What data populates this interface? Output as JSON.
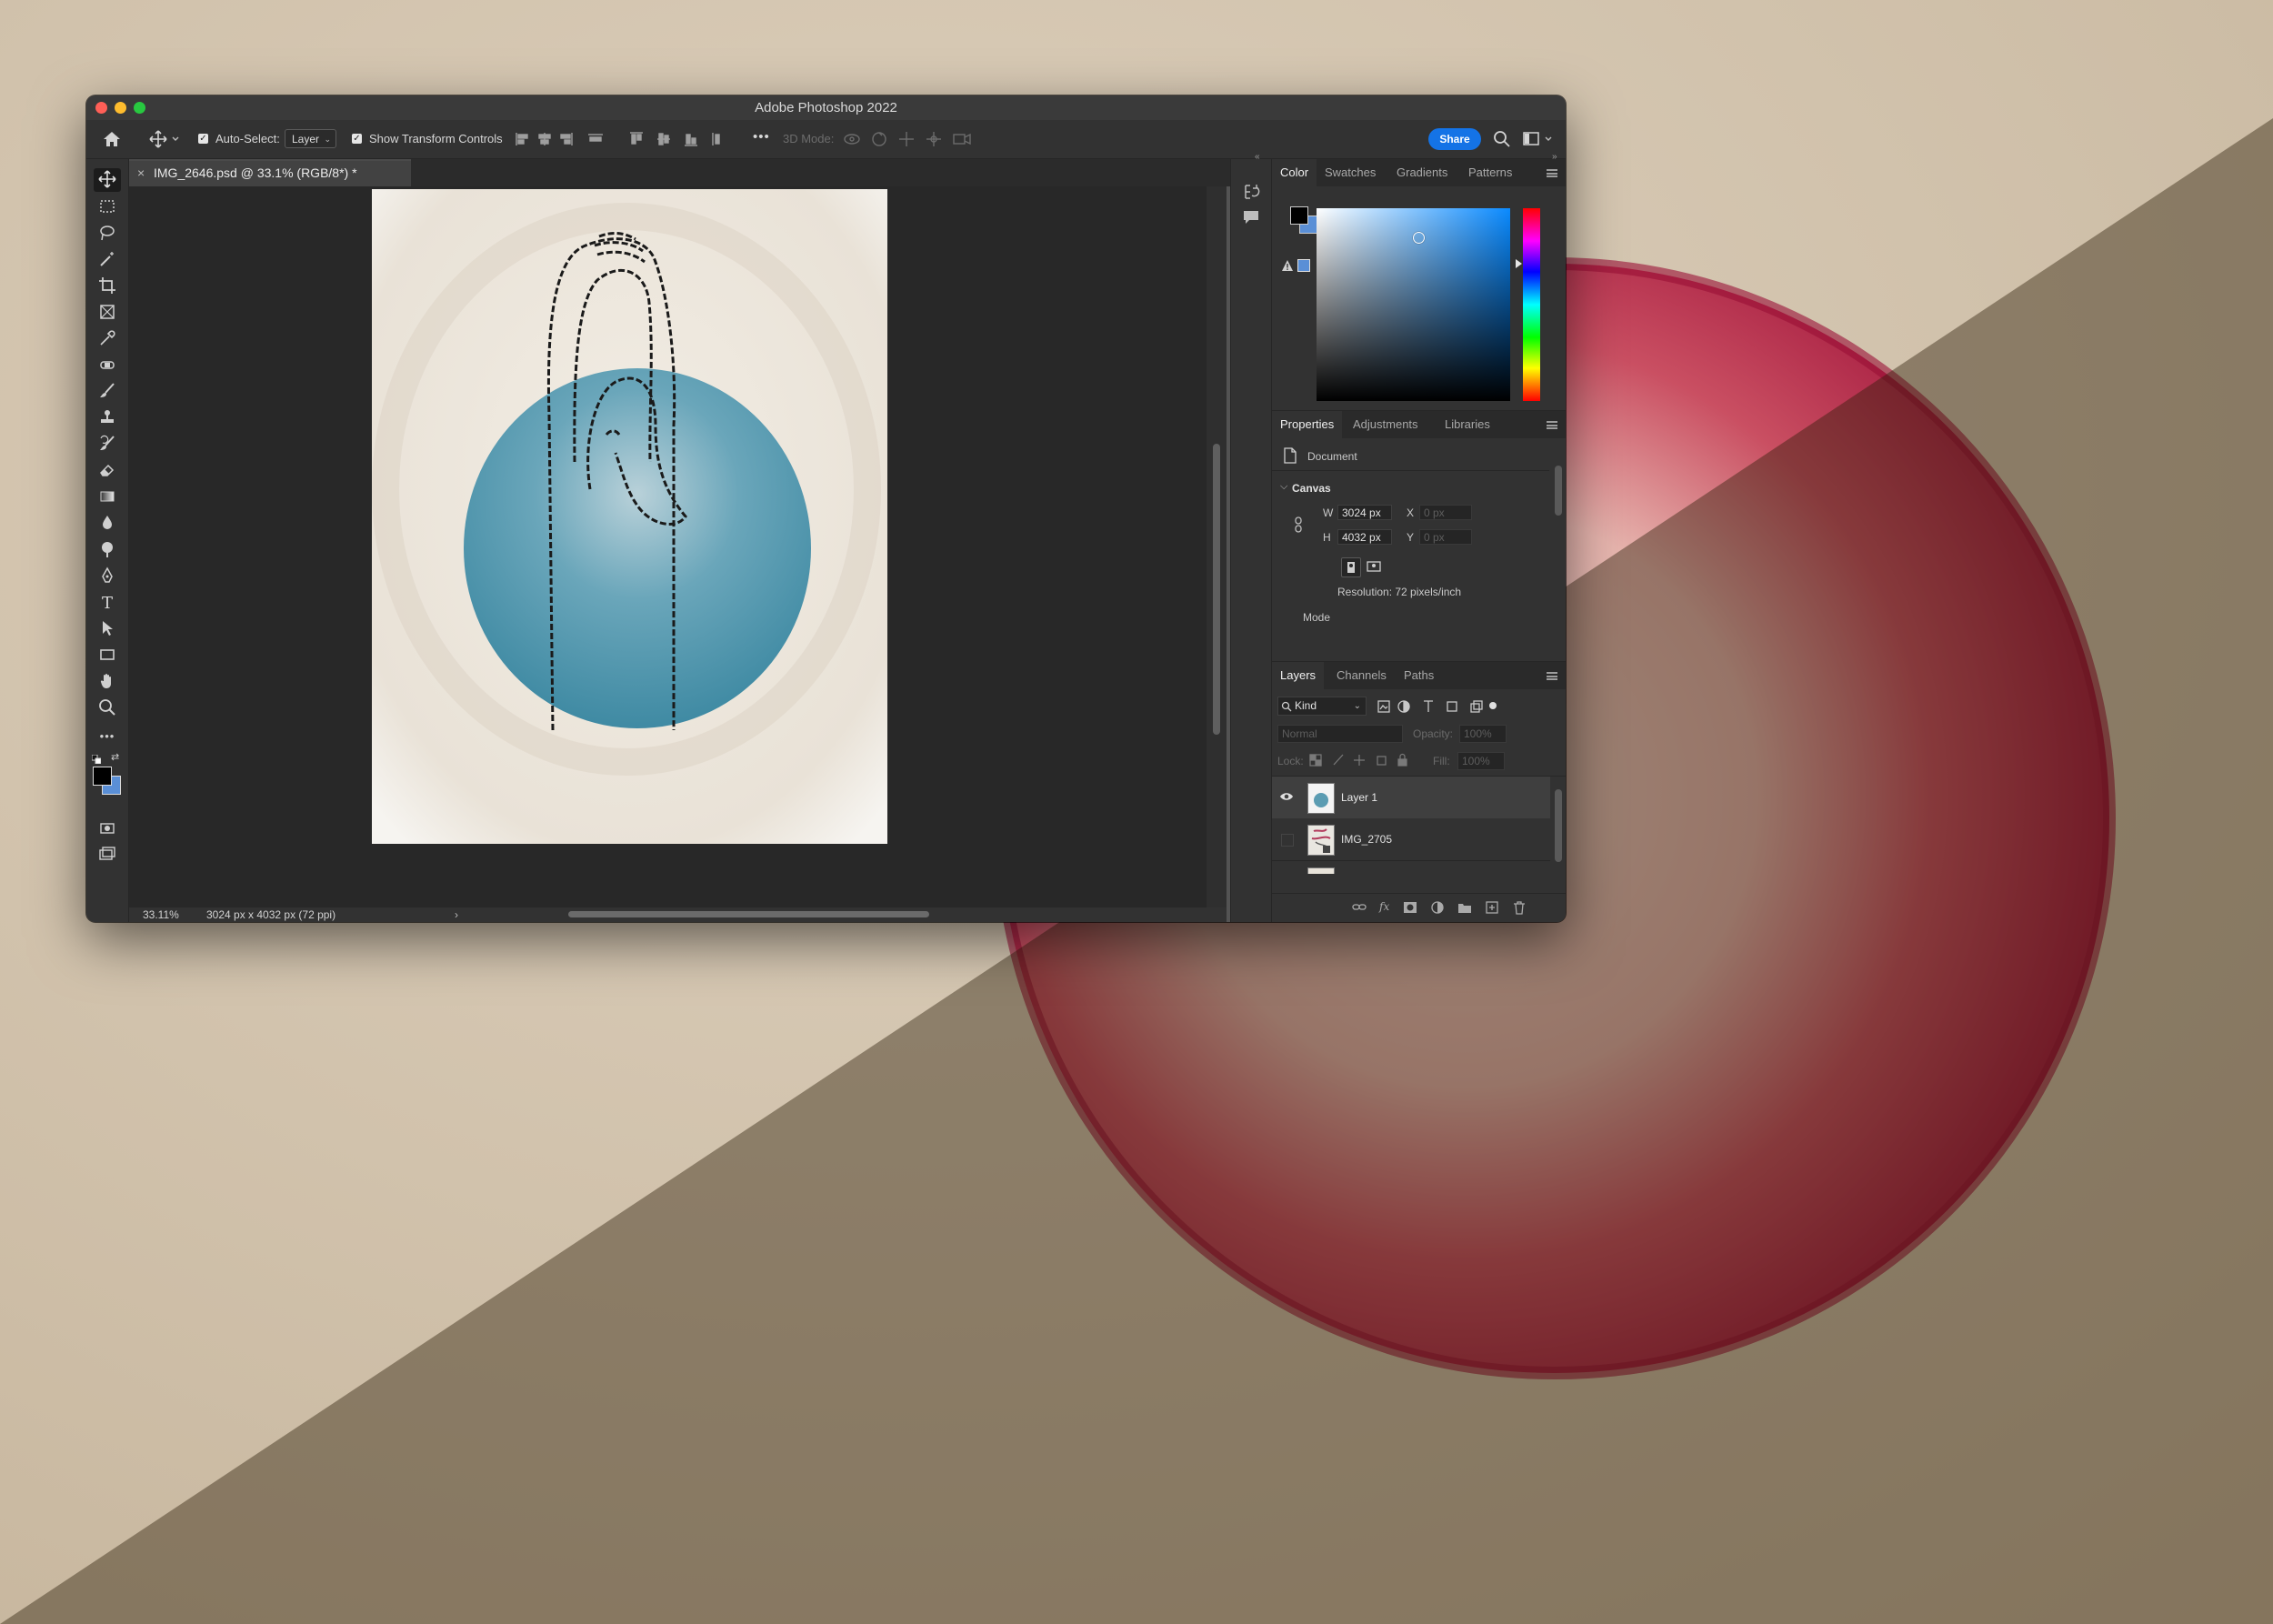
{
  "window": {
    "title": "Adobe Photoshop 2022",
    "traffic_colors": [
      "#ff5f57",
      "#febc2e",
      "#28c840"
    ]
  },
  "options_bar": {
    "auto_select_label": "Auto-Select:",
    "auto_select_checked": true,
    "auto_select_value": "Layer",
    "show_transform_label": "Show Transform Controls",
    "show_transform_checked": true,
    "more_label": "•••",
    "mode_3d_label": "3D Mode:",
    "share_label": "Share"
  },
  "document": {
    "tab_close": "×",
    "tab_title": "IMG_2646.psd @ 33.1% (RGB/8*) *"
  },
  "status_bar": {
    "zoom": "33.11%",
    "doc_info": "3024 px x 4032 px (72 ppi)",
    "chevron": "›"
  },
  "color_panel": {
    "tabs": [
      "Color",
      "Swatches",
      "Gradients",
      "Patterns"
    ],
    "active_tab": "Color",
    "foreground": "#000000",
    "background": "#5a8fd6",
    "hue_hex": "#0a8aff"
  },
  "properties_panel": {
    "tabs": [
      "Properties",
      "Adjustments",
      "Libraries"
    ],
    "active_tab": "Properties",
    "doc_label": "Document",
    "canvas_label": "Canvas",
    "w_label": "W",
    "w_value": "3024 px",
    "h_label": "H",
    "h_value": "4032 px",
    "x_label": "X",
    "x_placeholder": "0 px",
    "y_label": "Y",
    "y_placeholder": "0 px",
    "resolution": "Resolution: 72 pixels/inch",
    "mode_label": "Mode"
  },
  "layers_panel": {
    "tabs": [
      "Layers",
      "Channels",
      "Paths"
    ],
    "active_tab": "Layers",
    "filter_label": "Kind",
    "blend_mode": "Normal",
    "opacity_label": "Opacity:",
    "opacity_value": "100%",
    "lock_label": "Lock:",
    "fill_label": "Fill:",
    "fill_value": "100%",
    "layers": [
      {
        "name": "Layer 1",
        "visible": true
      },
      {
        "name": "IMG_2705",
        "visible": false
      }
    ],
    "footer_fx": "fx"
  },
  "toolbar": {
    "text_tool_glyph": "T",
    "more_glyph": "•••"
  }
}
